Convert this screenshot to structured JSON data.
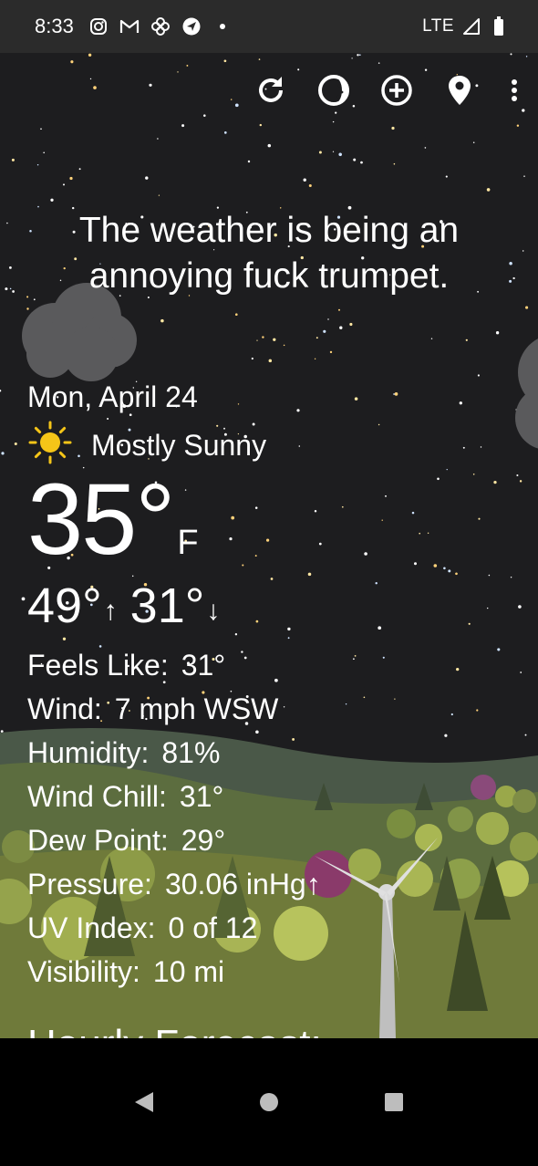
{
  "status_bar": {
    "time": "8:33",
    "network": "LTE",
    "icons": [
      "instagram-icon",
      "gmail-icon",
      "pinwheel-icon",
      "location-arrow-icon",
      "dot-icon",
      "signal-icon",
      "battery-icon"
    ]
  },
  "toolbar": {
    "icons": [
      "refresh-icon",
      "moon-phase-icon",
      "add-location-icon",
      "location-pin-icon",
      "more-vert-icon"
    ]
  },
  "headline": "The weather is being an annoying fuck trumpet.",
  "weather": {
    "date": "Mon, April 24",
    "condition": "Mostly Sunny",
    "condition_icon": "sun-icon",
    "temperature": "35°",
    "unit": "F",
    "high": "49°",
    "low": "31°",
    "high_arrow": "↑",
    "low_arrow": "↓"
  },
  "details": [
    {
      "label": "Feels Like:",
      "value": "31°"
    },
    {
      "label": "Wind:",
      "value": "7 mph WSW"
    },
    {
      "label": "Humidity:",
      "value": "81%"
    },
    {
      "label": "Wind Chill:",
      "value": "31°"
    },
    {
      "label": "Dew Point:",
      "value": "29°"
    },
    {
      "label": "Pressure:",
      "value": "30.06 inHg↑"
    },
    {
      "label": "UV Index:",
      "value": "0 of 12"
    },
    {
      "label": "Visibility:",
      "value": "10 mi"
    }
  ],
  "hourly_heading": "Hourly Forecast:",
  "nav": {
    "icons": [
      "back-icon",
      "home-icon",
      "recents-icon"
    ]
  },
  "colors": {
    "sky": "#1d1d1f",
    "status_bar": "#2b2b2b",
    "sun": "#f5c518",
    "cloud": "#5a5a5c"
  }
}
